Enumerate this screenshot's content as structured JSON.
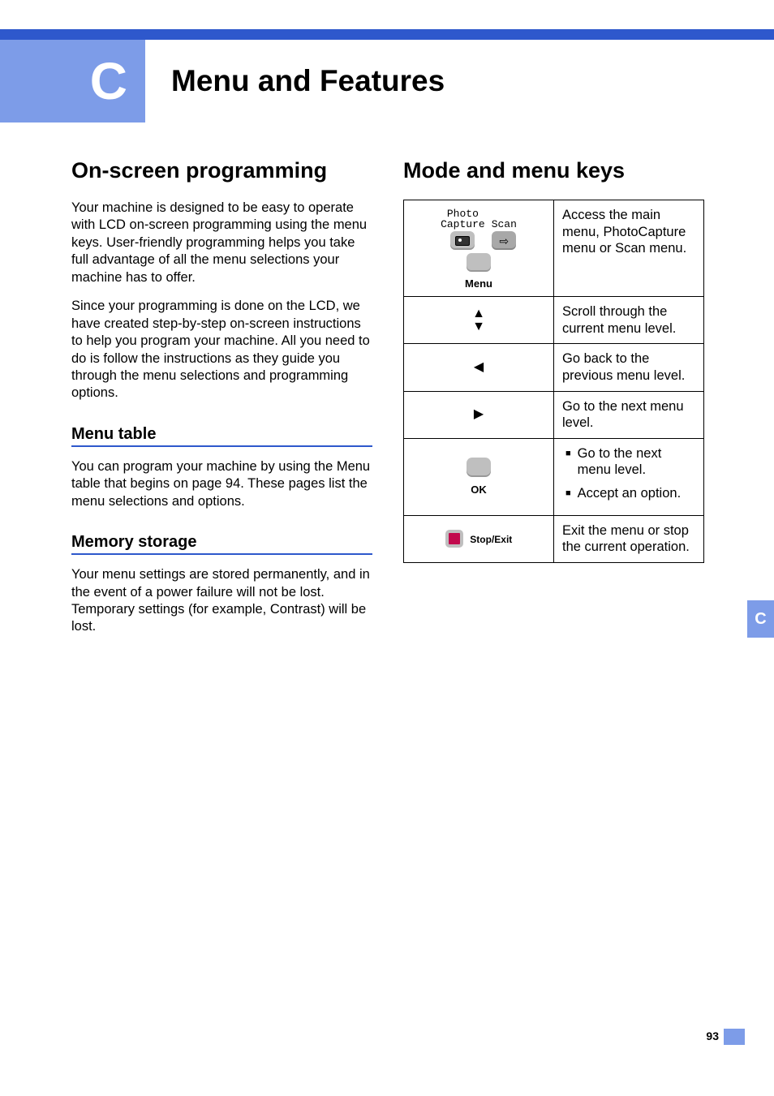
{
  "chapter": {
    "letter": "C",
    "title": "Menu and Features"
  },
  "left": {
    "h1": "On-screen programming",
    "p1": "Your machine is designed to be easy to operate with LCD on-screen programming using the menu keys. User-friendly programming helps you take full advantage of all the menu selections your machine has to offer.",
    "p2": "Since your programming is done on the LCD, we have created step-by-step on-screen instructions to help you program your machine. All you need to do is follow the instructions as they guide you through the menu selections and programming options.",
    "sub1": "Menu table",
    "p3": "You can program your machine by using the Menu table that begins on page 94. These pages list the menu selections and options.",
    "sub2": "Memory storage",
    "p4": "Your menu settings are stored permanently, and in the event of a power failure will not be lost. Temporary settings (for example, Contrast) will be lost."
  },
  "right": {
    "h1": "Mode and menu keys",
    "table": {
      "row1": {
        "label_photo": "Photo",
        "label_capture": "Capture",
        "label_scan": "Scan",
        "label_menu": "Menu",
        "desc": "Access the main menu, PhotoCapture menu or Scan menu."
      },
      "row2": {
        "up": "▲",
        "down": "▼",
        "desc": "Scroll through the current menu level."
      },
      "row3": {
        "left": "◀",
        "desc": "Go back to the previous menu level."
      },
      "row4": {
        "right": "▶",
        "desc": "Go to the next menu level."
      },
      "row5": {
        "ok": "OK",
        "b1": "Go to the next menu level.",
        "b2": "Accept an option."
      },
      "row6": {
        "stop": "Stop/Exit",
        "desc": "Exit the menu or stop the current operation."
      }
    }
  },
  "side_tab": "C",
  "page_number": "93"
}
